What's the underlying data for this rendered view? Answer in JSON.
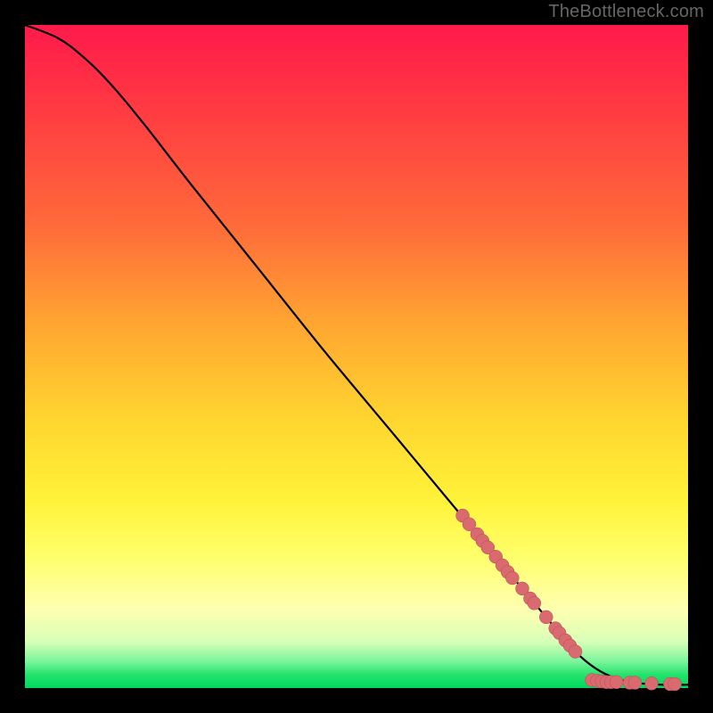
{
  "watermark": "TheBottleneck.com",
  "chart_data": {
    "type": "line",
    "title": "",
    "xlabel": "",
    "ylabel": "",
    "xlim": [
      0,
      100
    ],
    "ylim": [
      0,
      100
    ],
    "curve": [
      {
        "x": 0,
        "y": 100
      },
      {
        "x": 5,
        "y": 98
      },
      {
        "x": 9,
        "y": 95
      },
      {
        "x": 13,
        "y": 91
      },
      {
        "x": 18,
        "y": 85
      },
      {
        "x": 25,
        "y": 76
      },
      {
        "x": 35,
        "y": 63.5
      },
      {
        "x": 45,
        "y": 51
      },
      {
        "x": 55,
        "y": 39
      },
      {
        "x": 65,
        "y": 27
      },
      {
        "x": 70,
        "y": 21
      },
      {
        "x": 75,
        "y": 15
      },
      {
        "x": 80,
        "y": 9
      },
      {
        "x": 83,
        "y": 5.5
      },
      {
        "x": 86,
        "y": 3
      },
      {
        "x": 89,
        "y": 1.5
      },
      {
        "x": 92,
        "y": 0.8
      },
      {
        "x": 96,
        "y": 0.5
      },
      {
        "x": 100,
        "y": 0.5
      }
    ],
    "markers": [
      {
        "x": 66,
        "y": 26
      },
      {
        "x": 67,
        "y": 24.7
      },
      {
        "x": 68.2,
        "y": 23.2
      },
      {
        "x": 69,
        "y": 22.2
      },
      {
        "x": 69.8,
        "y": 21.2
      },
      {
        "x": 71,
        "y": 19.8
      },
      {
        "x": 72,
        "y": 18.5
      },
      {
        "x": 72.8,
        "y": 17.5
      },
      {
        "x": 73.5,
        "y": 16.6
      },
      {
        "x": 75,
        "y": 15
      },
      {
        "x": 76.2,
        "y": 13.5
      },
      {
        "x": 76.8,
        "y": 12.8
      },
      {
        "x": 78.6,
        "y": 10.7
      },
      {
        "x": 80,
        "y": 9
      },
      {
        "x": 80.6,
        "y": 8.3
      },
      {
        "x": 81.5,
        "y": 7.2
      },
      {
        "x": 82.2,
        "y": 6.4
      },
      {
        "x": 83,
        "y": 5.5
      },
      {
        "x": 85.5,
        "y": 1.2
      },
      {
        "x": 86.3,
        "y": 1.1
      },
      {
        "x": 87,
        "y": 1.0
      },
      {
        "x": 87.7,
        "y": 0.9
      },
      {
        "x": 88.4,
        "y": 0.9
      },
      {
        "x": 89.2,
        "y": 0.9
      },
      {
        "x": 91.2,
        "y": 0.8
      },
      {
        "x": 92,
        "y": 0.8
      },
      {
        "x": 94.5,
        "y": 0.7
      },
      {
        "x": 97.3,
        "y": 0.6
      },
      {
        "x": 98,
        "y": 0.6
      }
    ]
  }
}
